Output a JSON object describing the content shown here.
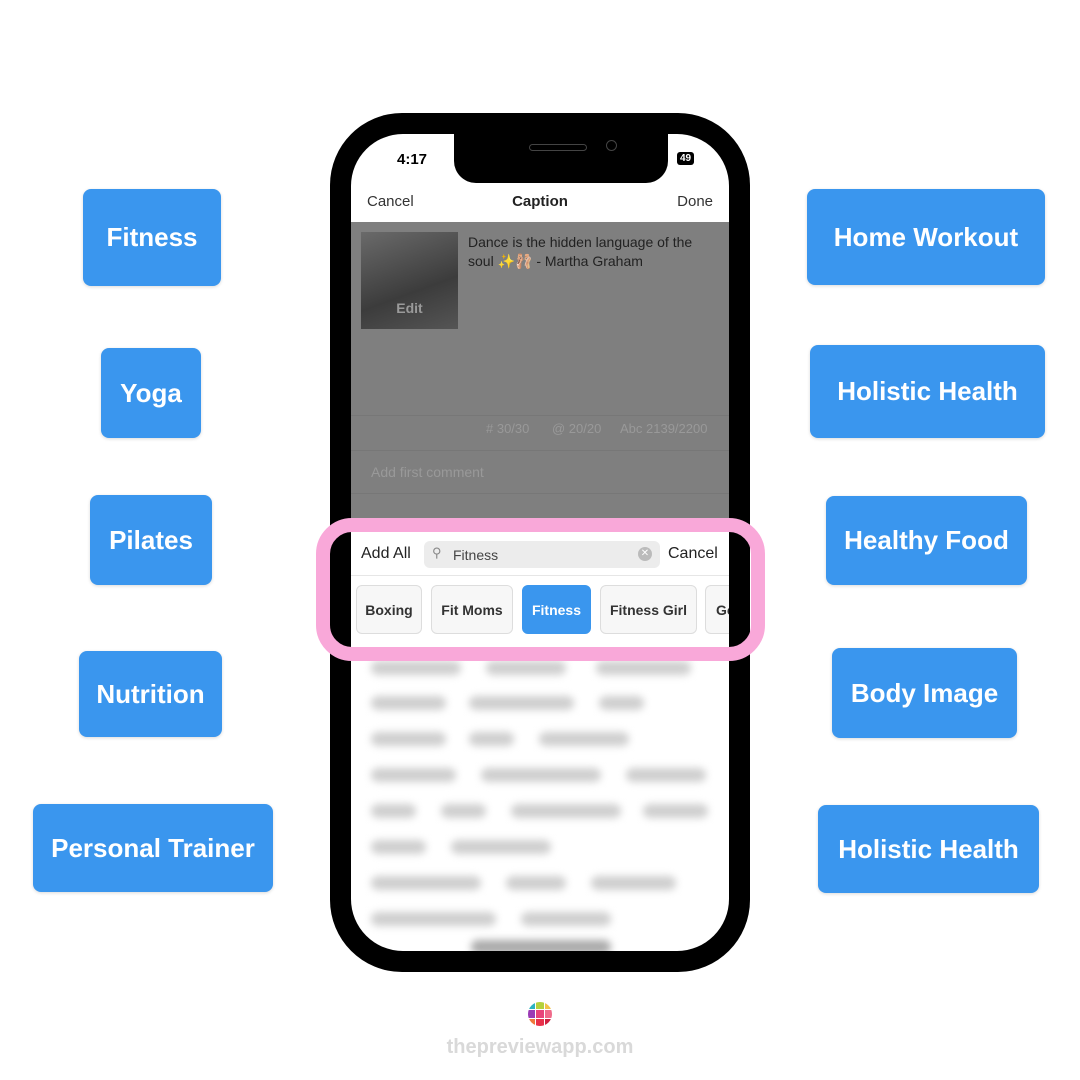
{
  "left_tags": [
    "Fitness",
    "Yoga",
    "Pilates",
    "Nutrition",
    "Personal Trainer"
  ],
  "right_tags": [
    "Home Workout",
    "Holistic Health",
    "Healthy Food",
    "Body Image",
    "Holistic Health"
  ],
  "status": {
    "time": "4:17",
    "battery": "49"
  },
  "nav": {
    "cancel": "Cancel",
    "title": "Caption",
    "done": "Done"
  },
  "post": {
    "caption": "Dance is the hidden language of the soul ✨🩰 - Martha Graham",
    "edit": "Edit"
  },
  "counters": {
    "hashtags": "# 30/30",
    "mentions": "@ 20/20",
    "chars": "Abc 2139/2200"
  },
  "comment_placeholder": "Add first comment",
  "search": {
    "add_all": "Add All",
    "value": "Fitness",
    "cancel": "Cancel"
  },
  "chips": [
    {
      "label": "Boxing",
      "selected": false
    },
    {
      "label": "Fit Moms",
      "selected": false
    },
    {
      "label": "Fitness",
      "selected": true
    },
    {
      "label": "Fitness Girl",
      "selected": false
    },
    {
      "label": "Go",
      "selected": false
    }
  ],
  "footer": {
    "brand": "thepreviewapp.com"
  },
  "colors": {
    "tag_blue": "#3a96ee",
    "highlight_pink": "#f9a8d9"
  }
}
